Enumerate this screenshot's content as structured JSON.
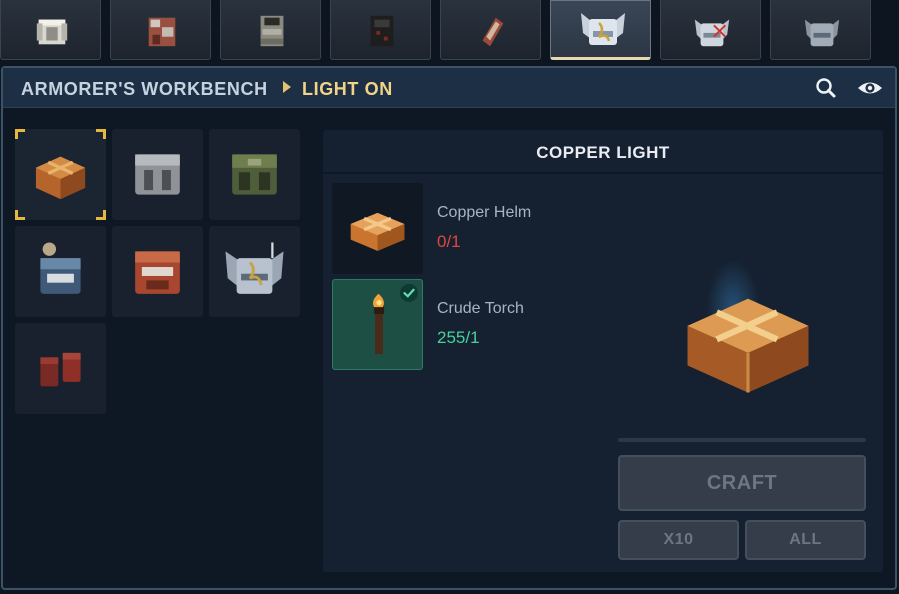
{
  "tabs": [
    {
      "icon": "white-armor-icon",
      "active": false
    },
    {
      "icon": "rusty-armor-icon",
      "active": false
    },
    {
      "icon": "stone-armor-icon",
      "active": false
    },
    {
      "icon": "dark-armor-icon",
      "active": false
    },
    {
      "icon": "leggings-icon",
      "active": false
    },
    {
      "icon": "winged-helm-icon",
      "active": true
    },
    {
      "icon": "winged-helm-crossed-icon",
      "active": false
    },
    {
      "icon": "winged-helm-faded-icon",
      "active": false
    }
  ],
  "header": {
    "station": "ARMORER'S WORKBENCH",
    "category": "LIGHT ON",
    "search_icon": "search-icon",
    "view_icon": "eye-icon"
  },
  "recipes": [
    {
      "icon": "copper-light-icon",
      "selected": true
    },
    {
      "icon": "iron-helm-icon",
      "selected": false
    },
    {
      "icon": "mossy-helm-icon",
      "selected": false
    },
    {
      "icon": "crested-helm-icon",
      "selected": false
    },
    {
      "icon": "red-helm-icon",
      "selected": false
    },
    {
      "icon": "winged-helm-icon",
      "selected": false
    },
    {
      "icon": "red-boots-icon",
      "selected": false
    }
  ],
  "detail": {
    "title": "COPPER LIGHT",
    "ingredients": [
      {
        "name": "Copper Helm",
        "count": "0/1",
        "status": "missing",
        "icon": "copper-helm-icon",
        "color": "#e0463c"
      },
      {
        "name": "Crude Torch",
        "count": "255/1",
        "status": "ok",
        "icon": "torch-icon",
        "color": "#48d19a"
      }
    ],
    "result_icon": "copper-light-icon",
    "craft_label": "CRAFT",
    "x10_label": "X10",
    "all_label": "ALL"
  },
  "colors": {
    "accent_gold": "#e8b83e",
    "header_bg": "#1c2f44",
    "missing": "#e0463c",
    "ok": "#48d19a"
  }
}
